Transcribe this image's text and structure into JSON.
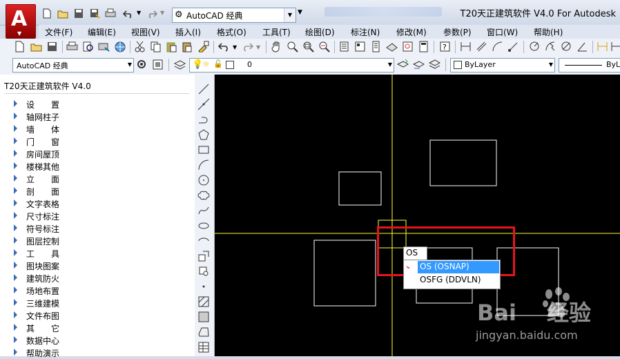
{
  "title_bar": {
    "workspace": "AutoCAD 经典",
    "title": "T20天正建筑软件 V4.0 For Autodesk"
  },
  "menu": [
    "文件(F)",
    "编辑(E)",
    "视图(V)",
    "插入(I)",
    "格式(O)",
    "工具(T)",
    "绘图(D)",
    "标注(N)",
    "修改(M)",
    "参数(P)",
    "窗口(W)",
    "帮助(H)"
  ],
  "toolbar2": {
    "workspace": "AutoCAD 经典",
    "layer": "0",
    "color": "ByLayer",
    "linetype": "ByL"
  },
  "panel": {
    "title": "T20天正建筑软件 V4.0",
    "items": [
      "设　　置",
      "轴网柱子",
      "墙　　体",
      "门　　窗",
      "房间屋顶",
      "楼梯其他",
      "立　　面",
      "剖　　面",
      "文字表格",
      "尺寸标注",
      "符号标注",
      "图层控制",
      "工　　具",
      "图块图案",
      "建筑防火",
      "场地布置",
      "三维建模",
      "文件布图",
      "其　　它",
      "数据中心",
      "帮助演示"
    ]
  },
  "command": {
    "input": "OS",
    "suggestions": [
      "OS (OSNAP)",
      "OSFG (DDVLN)"
    ]
  },
  "watermark": {
    "brand": "Bai",
    "brand_cn": "经验",
    "url": "jingyan.baidu.com"
  },
  "colors": {
    "canvas": "#000000",
    "crosshair": "#ffff33",
    "highlight": "#e8131b",
    "selected": "#3399ff"
  }
}
